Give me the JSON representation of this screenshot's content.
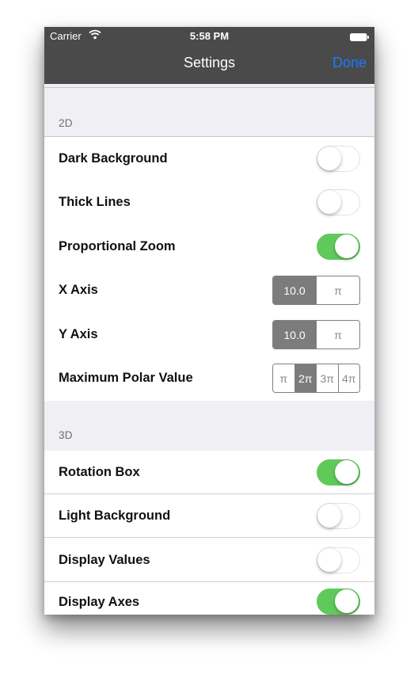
{
  "status": {
    "carrier": "Carrier",
    "time": "5:58 PM"
  },
  "nav": {
    "title": "Settings",
    "done": "Done"
  },
  "colors": {
    "toggle_on": "#5fca5a",
    "nav_bg": "#4a4a4a",
    "done_blue": "#1a7cff",
    "segment_selected": "#7c7c7c"
  },
  "sections": {
    "s2d": {
      "header": "2D",
      "dark_background": {
        "label": "Dark Background",
        "on": false
      },
      "thick_lines": {
        "label": "Thick Lines",
        "on": false
      },
      "proportional_zoom": {
        "label": "Proportional Zoom",
        "on": true
      },
      "x_axis": {
        "label": "X Axis",
        "options": [
          "10.0",
          "π"
        ],
        "selected": "10.0"
      },
      "y_axis": {
        "label": "Y Axis",
        "options": [
          "10.0",
          "π"
        ],
        "selected": "10.0"
      },
      "max_polar": {
        "label": "Maximum Polar Value",
        "options": [
          "π",
          "2π",
          "3π",
          "4π"
        ],
        "selected": "2π"
      }
    },
    "s3d": {
      "header": "3D",
      "rotation_box": {
        "label": "Rotation Box",
        "on": true
      },
      "light_background": {
        "label": "Light Background",
        "on": false
      },
      "display_values": {
        "label": "Display Values",
        "on": false
      },
      "display_axes": {
        "label": "Display Axes",
        "on": true
      }
    }
  }
}
